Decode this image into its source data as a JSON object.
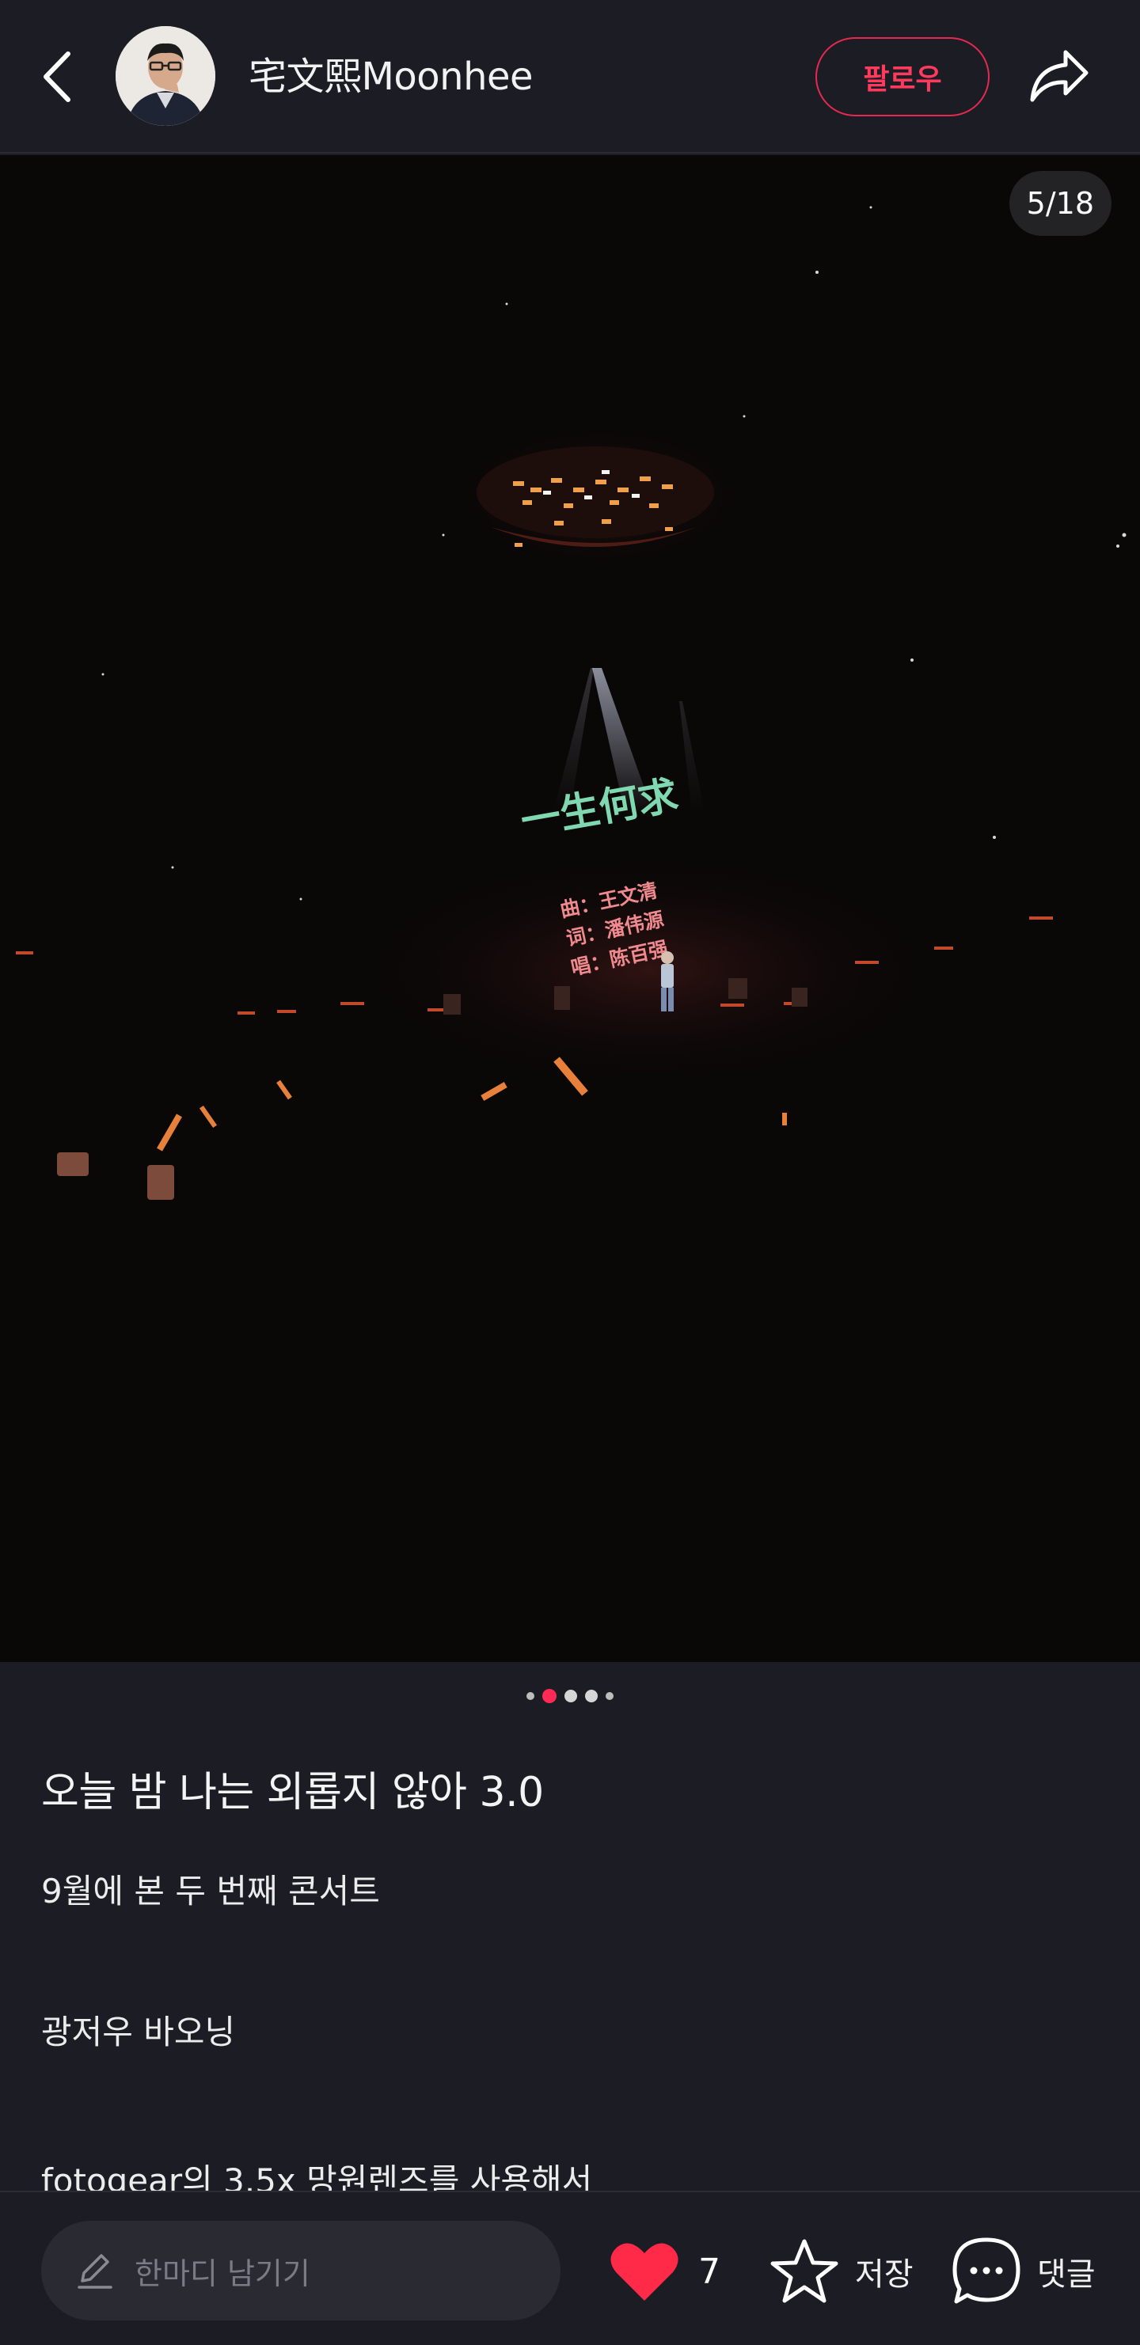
{
  "header": {
    "username": "宅文熙Moonhee",
    "follow_label": "팔로우"
  },
  "photo": {
    "page_indicator": "5/18",
    "current_index": 5,
    "total": 18,
    "screen_title": "一生何求",
    "screen_credits": [
      "曲：王文清",
      "词：潘伟源",
      "唱：陈百强"
    ]
  },
  "post": {
    "title": "오늘 밤 나는 외롭지 않아 3.0",
    "lines": [
      "9월에 본 두 번째 콘서트",
      "광저우 바오닝",
      "fotogear의 3.5x 망원렌즈를 사용해서"
    ]
  },
  "bottom_bar": {
    "comment_placeholder": "한마디 남기기",
    "like_count": "7",
    "save_label": "저장",
    "comment_label": "댓글"
  },
  "colors": {
    "background": "#1c1c25",
    "accent": "#ff2b55",
    "like_heart": "#ff2a48"
  },
  "icons": [
    "back-icon",
    "share-icon",
    "pencil-icon",
    "heart-icon",
    "star-icon",
    "chat-bubble-icon"
  ]
}
